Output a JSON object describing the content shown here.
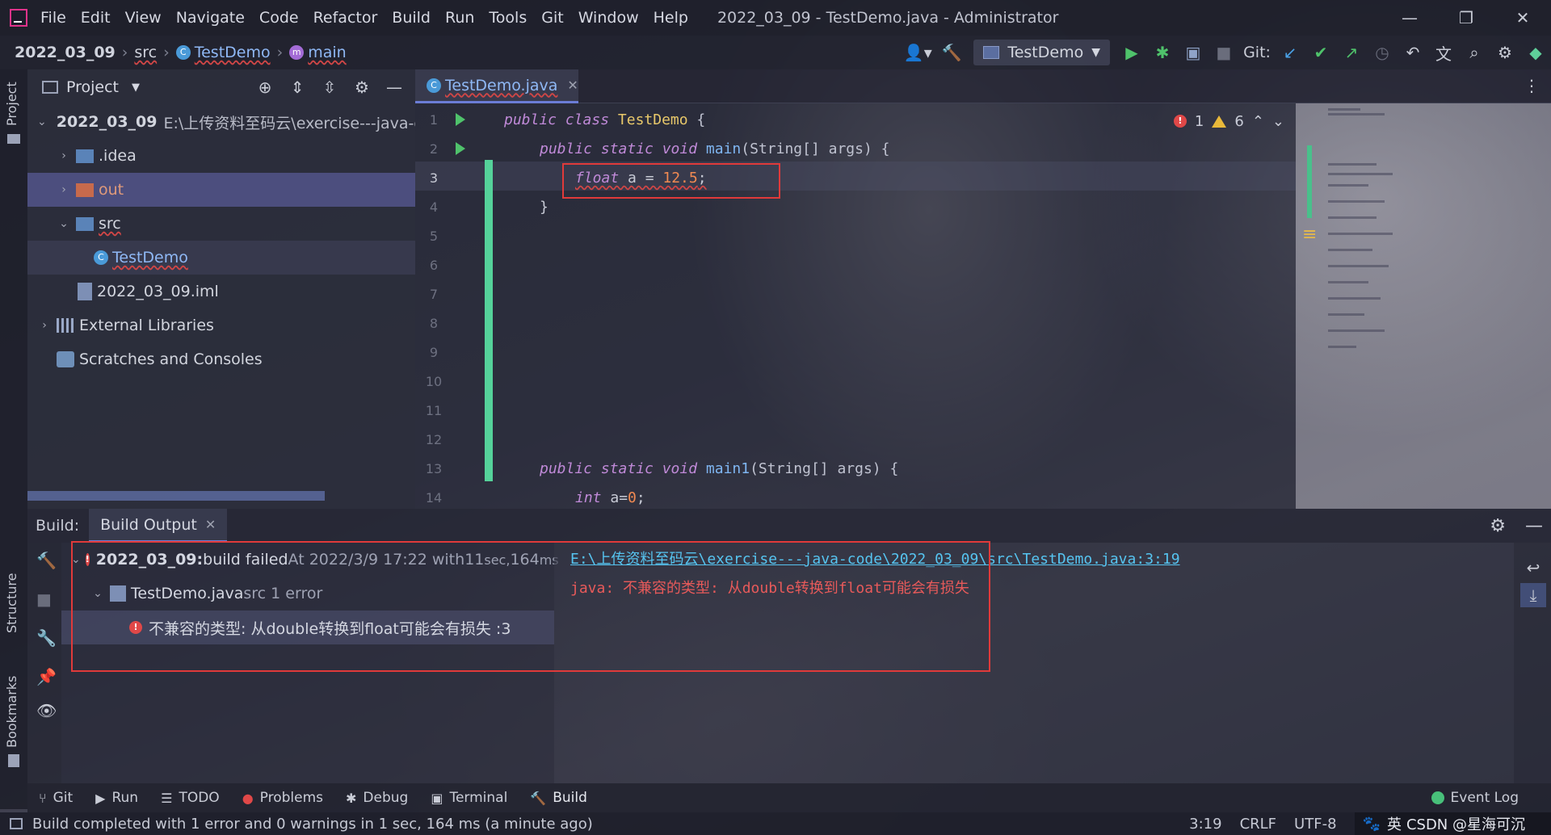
{
  "window": {
    "title": "2022_03_09 - TestDemo.java - Administrator",
    "controls": {
      "minimize": "—",
      "restore": "❐",
      "close": "✕"
    }
  },
  "menu": [
    "File",
    "Edit",
    "View",
    "Navigate",
    "Code",
    "Refactor",
    "Build",
    "Run",
    "Tools",
    "Git",
    "Window",
    "Help"
  ],
  "breadcrumb": {
    "project": "2022_03_09",
    "folder": "src",
    "class": "TestDemo",
    "method": "main"
  },
  "toolbar": {
    "run_config": "TestDemo",
    "git_label": "Git:",
    "icons": [
      "user-icon",
      "hammer-icon",
      "run-icon",
      "debug-icon",
      "coverage-icon",
      "stop-icon",
      "git-update-icon",
      "git-commit-icon",
      "git-push-icon",
      "history-icon",
      "rollback-icon",
      "translate-icon",
      "search-icon",
      "settings-icon",
      "plugin-icon"
    ]
  },
  "side_tabs": {
    "project": "Project",
    "structure": "Structure",
    "bookmarks": "Bookmarks"
  },
  "project_panel": {
    "title": "Project",
    "tree": [
      {
        "label": "2022_03_09",
        "extra": "E:\\上传资料至码云\\exercise---java-cc",
        "icon": "module-folder-icon"
      },
      {
        "label": ".idea",
        "icon": "folder-icon"
      },
      {
        "label": "out",
        "icon": "excluded-folder-icon"
      },
      {
        "label": "src",
        "icon": "source-folder-icon"
      },
      {
        "label": "TestDemo",
        "icon": "class-icon"
      },
      {
        "label": "2022_03_09.iml",
        "icon": "iml-file-icon"
      },
      {
        "label": "External Libraries",
        "icon": "library-icon"
      },
      {
        "label": "Scratches and Consoles",
        "icon": "scratches-icon"
      }
    ]
  },
  "editor": {
    "tab": "TestDemo.java",
    "inspections": {
      "errors": "1",
      "warnings": "6"
    },
    "line_numbers": [
      "1",
      "2",
      "3",
      "4",
      "5",
      "6",
      "7",
      "8",
      "9",
      "10",
      "11",
      "12",
      "13",
      "14"
    ],
    "code": [
      {
        "kw": "public class ",
        "name": "TestDemo",
        "rest": " {"
      },
      {
        "kw": "public static void ",
        "name": "main",
        "rest": "(String[] args) {"
      },
      {
        "kw": "float",
        "name": " a = ",
        "num": "12.5",
        "rest": ";"
      },
      {
        "rest": "}"
      },
      {
        "kw": "public static void ",
        "name": "main1",
        "rest": "(String[] args) {"
      },
      {
        "kw": "int",
        "name": " a=",
        "num": "0",
        "rest": ";"
      }
    ]
  },
  "build": {
    "label": "Build:",
    "tab": "Build Output",
    "root": {
      "name": "2022_03_09:",
      "status": " build failed",
      "time": " At 2022/3/9 17:22 with ",
      "duration_a": "11",
      "duration_b": " sec, ",
      "duration_c": "164",
      "duration_d": " ms"
    },
    "file": {
      "name": "TestDemo.java",
      "info": " src 1 error"
    },
    "error": "不兼容的类型: 从double转换到float可能会有损失 :3",
    "console_link": "E:\\上传资料至码云\\exercise---java-code\\2022_03_09\\src\\TestDemo.java:3:19",
    "console_message": "java: 不兼容的类型: 从double转换到float可能会有损失"
  },
  "tool_windows": [
    {
      "label": "Git",
      "icon": "git-icon"
    },
    {
      "label": "Run",
      "icon": "run-icon"
    },
    {
      "label": "TODO",
      "icon": "todo-icon"
    },
    {
      "label": "Problems",
      "icon": "problems-icon"
    },
    {
      "label": "Debug",
      "icon": "debug-icon"
    },
    {
      "label": "Terminal",
      "icon": "terminal-icon"
    },
    {
      "label": "Build",
      "icon": "build-icon"
    }
  ],
  "event_log": "Event Log",
  "status": {
    "message": "Build completed with 1 error and 0 warnings in 1 sec, 164 ms (a minute ago)",
    "position": "3:19",
    "line_sep": "CRLF",
    "encoding": "UTF-8",
    "watermark": "CSDN @星海可沉",
    "ime": "英"
  },
  "colors": {
    "accent": "#6b7dd6",
    "error": "#e03a3a",
    "link": "#56c4f0",
    "vcs_added": "#55d29a"
  }
}
